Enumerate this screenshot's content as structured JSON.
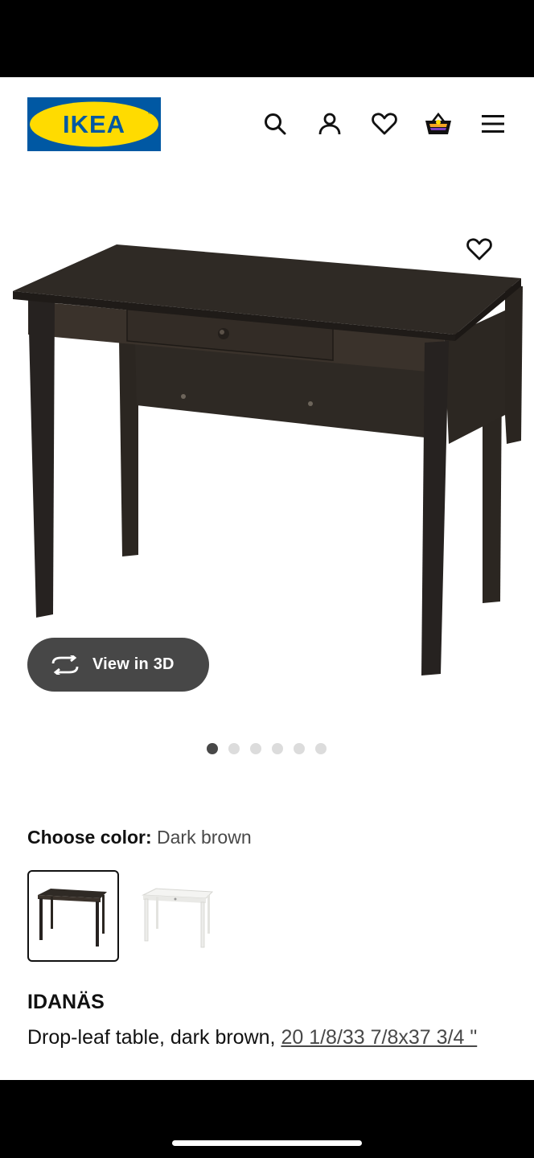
{
  "brand": {
    "logo_text": "IKEA",
    "blue": "#0058A3",
    "yellow": "#FFDB00"
  },
  "header": {
    "icons": [
      "search-icon",
      "account-icon",
      "favorites-icon",
      "shopping-bag-icon",
      "menu-icon"
    ]
  },
  "gallery": {
    "view_3d_label": "View in 3D",
    "image_count": 6,
    "active_index": 0
  },
  "color_choice": {
    "label": "Choose color:",
    "value": "Dark brown",
    "options": [
      "Dark brown",
      "White"
    ],
    "selected": "Dark brown"
  },
  "product": {
    "name": "IDANÄS",
    "description": "Drop-leaf table, dark brown, ",
    "dimensions": "20 1/8/33 7/8x37 3/4 \""
  }
}
